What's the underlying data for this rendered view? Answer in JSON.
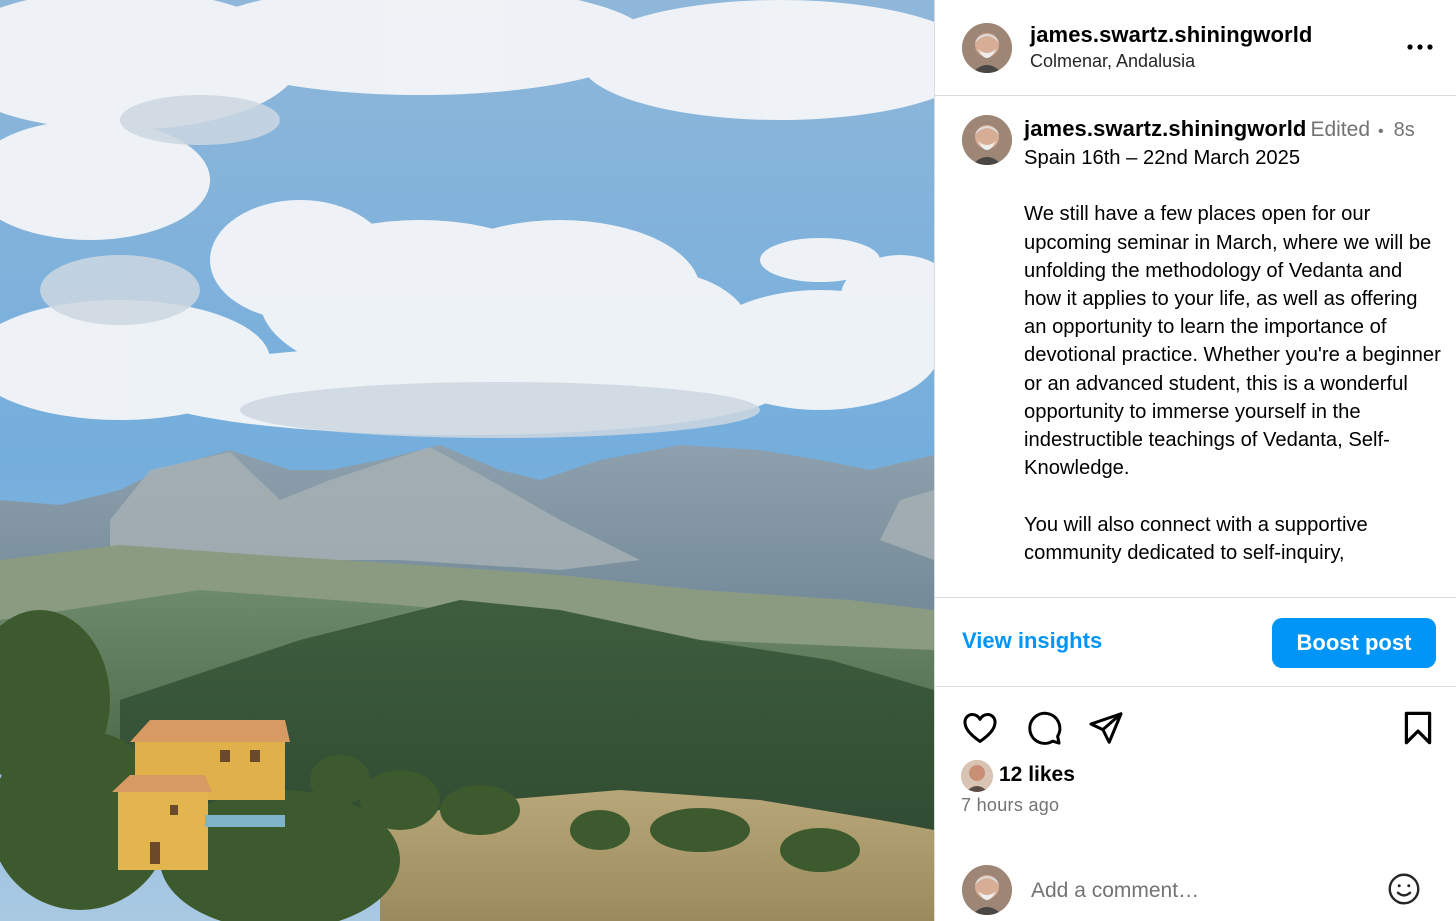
{
  "photo": {
    "alt": ""
  },
  "header": {
    "username": "james.swartz.shiningworld",
    "location": "Colmenar, Andalusia",
    "more_icon": "more-horizontal-icon"
  },
  "caption": {
    "username": "james.swartz.shiningworld",
    "edited": "Edited",
    "separator": "•",
    "time_ago": "8s",
    "text": "Spain 16th – 22nd March 2025\n\nWe still have a few places open for our upcoming seminar in March, where we will be unfolding the methodology of Vedanta and how it applies to your life, as well as offering an opportunity to learn the importance of devotional practice. Whether you're a beginner or an advanced student, this is a wonderful opportunity to immerse yourself in the indestructible teachings of Vedanta, Self-Knowledge.\n\nYou will also connect with a supportive community dedicated to self-inquiry,"
  },
  "insights": {
    "view_insights_label": "View insights",
    "boost_label": "Boost post"
  },
  "actions": {
    "like_icon": "heart-icon",
    "comment_icon": "comment-icon",
    "share_icon": "send-icon",
    "save_icon": "bookmark-icon"
  },
  "likes": {
    "count_label": "12 likes"
  },
  "timestamp": "7 hours ago",
  "comment": {
    "placeholder": "Add a comment…",
    "emoji_icon": "smiley-icon"
  },
  "colors": {
    "accent": "#0095f6",
    "border": "#dbdbdb",
    "muted": "#737373"
  }
}
